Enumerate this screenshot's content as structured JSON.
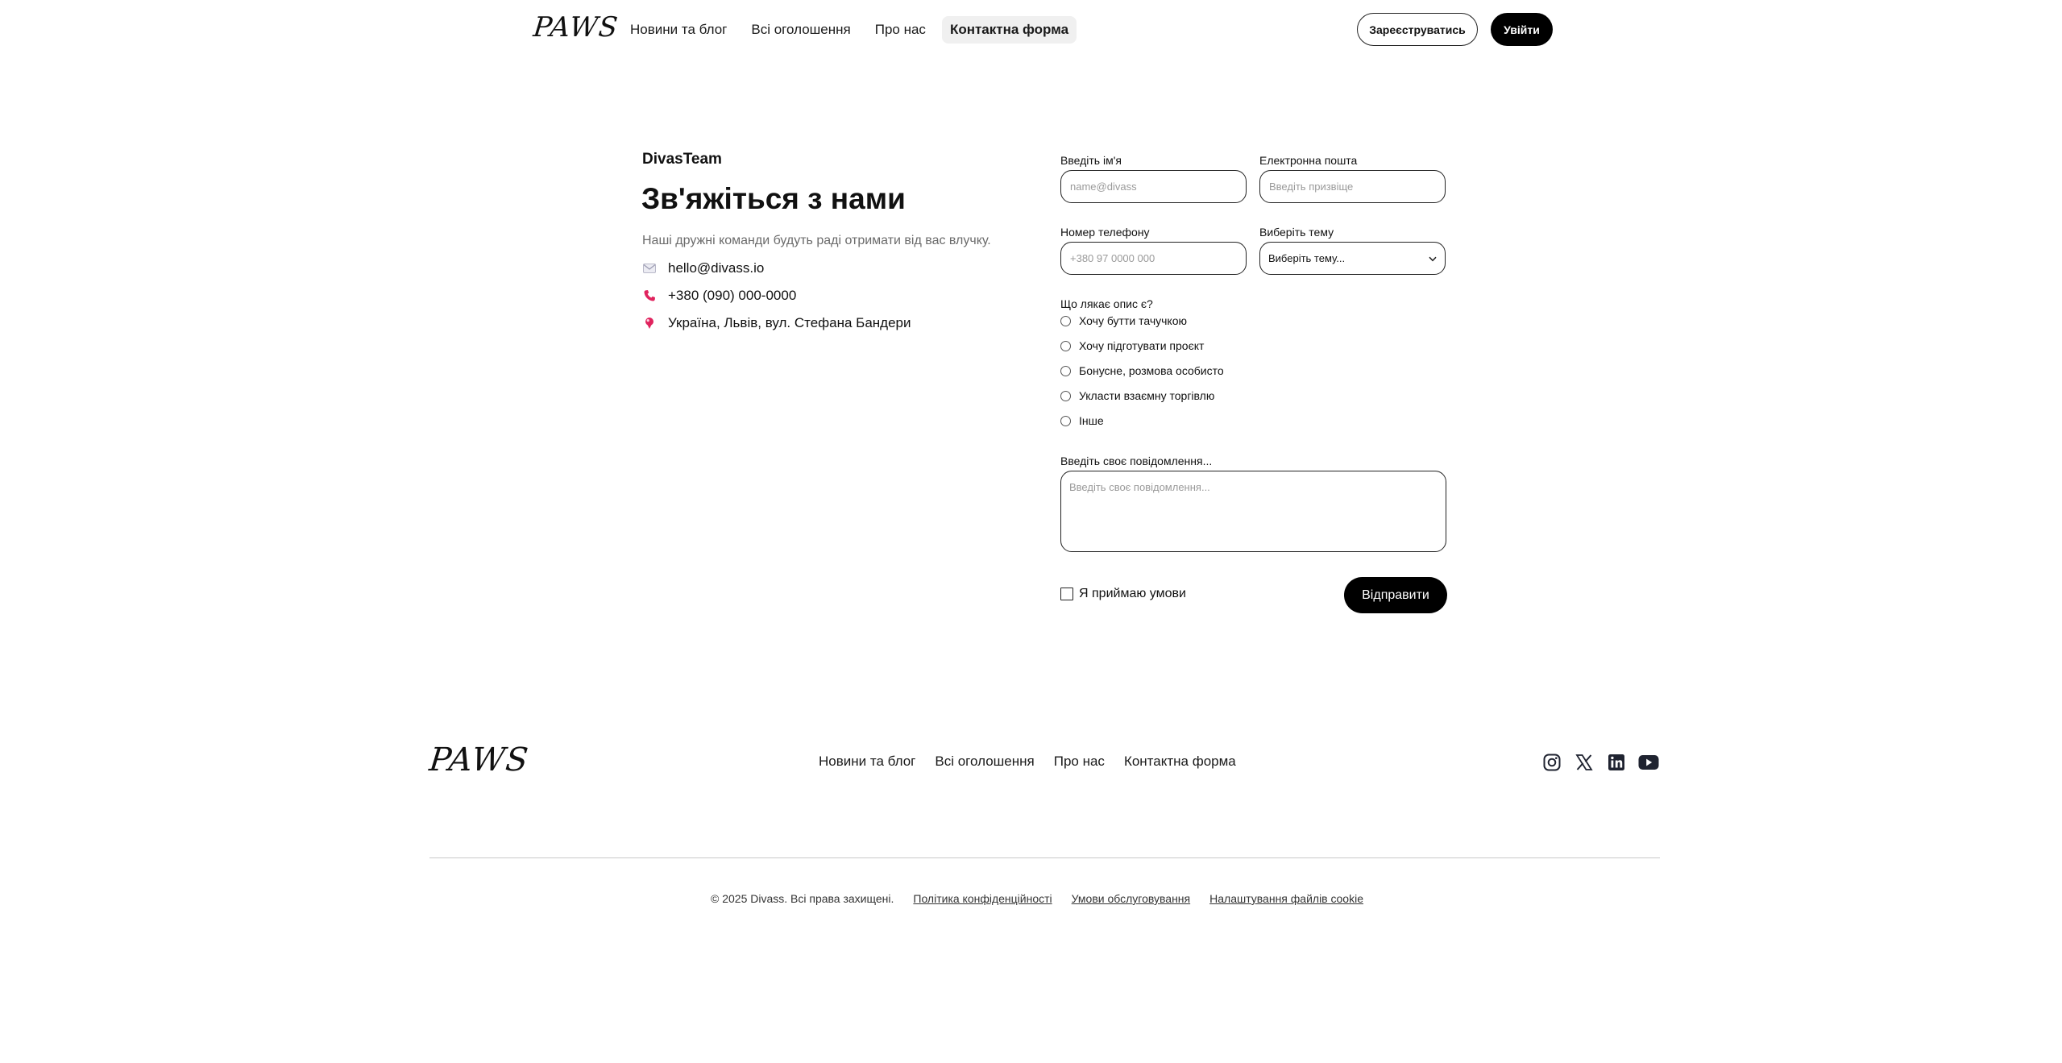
{
  "header": {
    "logo": "PAWS",
    "nav": [
      "Новини та блог",
      "Всі оголошення",
      "Про нас",
      "Контактна форма"
    ],
    "register_label": "Зареєструватись",
    "login_label": "Увійти"
  },
  "contact": {
    "team": "DivasTeam",
    "title": "Зв'яжіться з нами",
    "subtitle": "Наші дружні команди будуть раді отримати від вас влучку.",
    "email": "hello@divass.io",
    "phone": "+380 (090) 000-0000",
    "address": "Україна, Львів, вул. Стефана Бандери"
  },
  "form": {
    "name_label": "Введіть ім'я",
    "name_placeholder": "name@divass",
    "email_label": "Електронна пошта",
    "email_placeholder": "Введіть призвіще",
    "phone_label": "Номер телефону",
    "phone_placeholder": "+380 97 0000 000",
    "topic_label": "Виберіть тему",
    "topic_value": "Виберіть тему...",
    "radio_label": "Що лякає опис є?",
    "radio_options": [
      "Хочу бутти тачучкою",
      "Хочу підготувати проєкт",
      "Бонусне, розмова особисто",
      "Укласти взаємну торгівлю",
      "Інше"
    ],
    "message_label": "Введіть своє повідомлення...",
    "message_placeholder": "Введіть своє повідомлення...",
    "terms_label": "Я приймаю умови",
    "send_label": "Відправити"
  },
  "footer": {
    "logo": "PAWS",
    "nav": [
      "Новини та блог",
      "Всі оголошення",
      "Про нас",
      "Контактна форма"
    ],
    "socials": [
      "instagram-icon",
      "x-icon",
      "linkedin-icon",
      "youtube-icon"
    ],
    "copyright": "© 2025 Divass. Всі права захищені.",
    "privacy": "Політика конфіденційності",
    "terms": "Умови обслуговування",
    "cookies": "Налаштування файлів cookie"
  },
  "colors": {
    "accent_icon": "#e0245e",
    "text_muted": "#6b6b6b"
  }
}
